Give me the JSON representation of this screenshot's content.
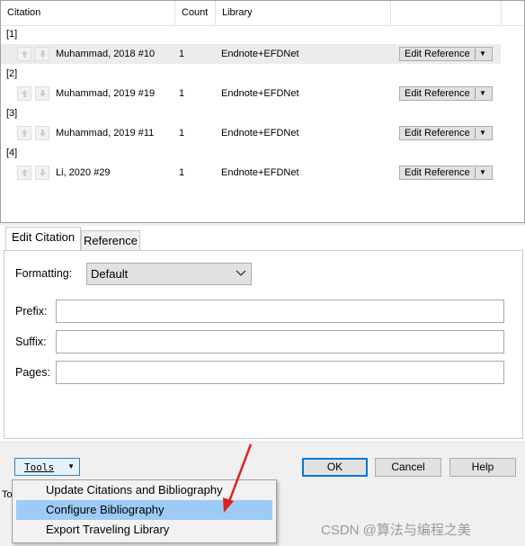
{
  "table": {
    "headers": {
      "citation": "Citation",
      "count": "Count",
      "library": "Library"
    },
    "groups": [
      {
        "label": "[1]",
        "citation": "Muhammad, 2018 #10",
        "count": "1",
        "library": "Endnote+EFDNet",
        "action": "Edit Reference",
        "selected": true
      },
      {
        "label": "[2]",
        "citation": "Muhammad, 2019 #19",
        "count": "1",
        "library": "Endnote+EFDNet",
        "action": "Edit Reference",
        "selected": false
      },
      {
        "label": "[3]",
        "citation": "Muhammad, 2019 #11",
        "count": "1",
        "library": "Endnote+EFDNet",
        "action": "Edit Reference",
        "selected": false
      },
      {
        "label": "[4]",
        "citation": "Li, 2020 #29",
        "count": "1",
        "library": "Endnote+EFDNet",
        "action": "Edit Reference",
        "selected": false
      }
    ]
  },
  "tabs": {
    "edit_citation": "Edit Citation",
    "reference": "Reference"
  },
  "form": {
    "formatting_label": "Formatting:",
    "formatting_value": "Default",
    "prefix_label": "Prefix:",
    "suffix_label": "Suffix:",
    "pages_label": "Pages:",
    "prefix_value": "",
    "suffix_value": "",
    "pages_value": ""
  },
  "bottom": {
    "tools_label": "Tools",
    "ok_label": "OK",
    "cancel_label": "Cancel",
    "help_label": "Help",
    "status_partial": "Tot"
  },
  "tools_menu": {
    "items": [
      {
        "label": "Update Citations and Bibliography",
        "highlighted": false
      },
      {
        "label": "Configure Bibliography",
        "highlighted": true
      },
      {
        "label": "Export Traveling Library",
        "highlighted": false
      }
    ]
  },
  "watermark": "CSDN @算法与编程之美",
  "colors": {
    "highlight": "#9dcbf5",
    "annotation_arrow": "#e02020",
    "primary_border": "#0078d7"
  }
}
